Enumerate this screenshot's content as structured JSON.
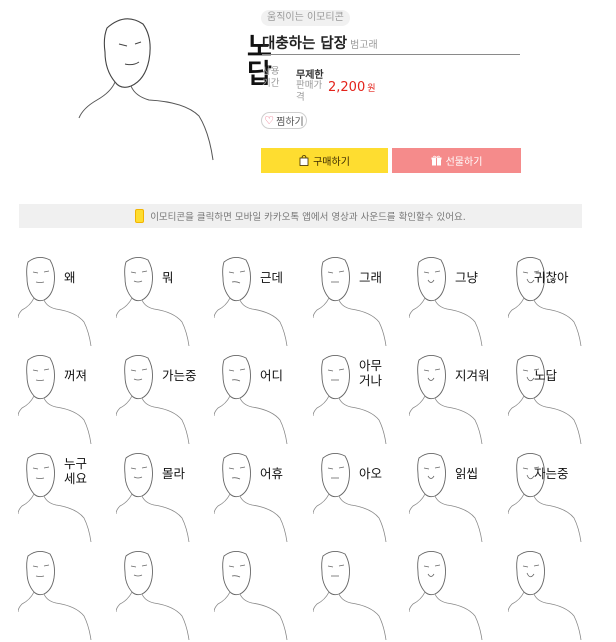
{
  "product": {
    "hero_text": "노답",
    "tag": "움직이는 이모티콘",
    "title": "대충하는 답장",
    "author": "범고래",
    "usage_label": "사용기간",
    "usage_value": "무제한",
    "price_label": "판매가격",
    "price": "2,200",
    "currency": "원",
    "like_label": "찜하기",
    "buy_label": "구매하기",
    "gift_label": "선물하기"
  },
  "info": {
    "text": "이모티콘을 클릭하면 모바일 카카오톡 앱에서 영상과 사운드를 확인할수 있어요."
  },
  "colors": {
    "buy": "#fedd30",
    "gift": "#f58b8b",
    "price": "#e3231b"
  },
  "emoticons": [
    {
      "label": "왜"
    },
    {
      "label": "뭐"
    },
    {
      "label": "근데"
    },
    {
      "label": "그래"
    },
    {
      "label": "그냥"
    },
    {
      "label": "귀찮아"
    },
    {
      "label": "꺼져"
    },
    {
      "label": "가는중"
    },
    {
      "label": "어디"
    },
    {
      "label": "아무\n거나"
    },
    {
      "label": "지겨워"
    },
    {
      "label": "노답"
    },
    {
      "label": "누구\n세요"
    },
    {
      "label": "몰라"
    },
    {
      "label": "어휴"
    },
    {
      "label": "아오"
    },
    {
      "label": "읽씹"
    },
    {
      "label": "자는중"
    }
  ]
}
